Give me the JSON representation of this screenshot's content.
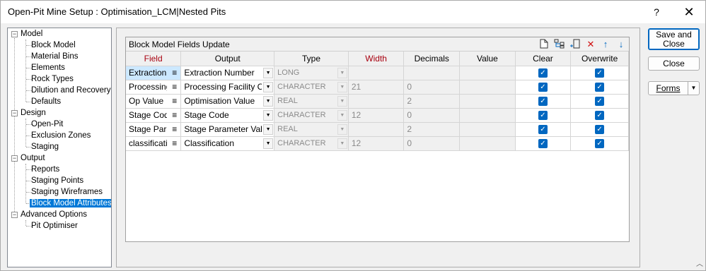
{
  "window": {
    "title": "Open-Pit Mine Setup : Optimisation_LCM|Nested Pits",
    "help_glyph": "?",
    "close_glyph": "✕"
  },
  "tree": {
    "groups": [
      {
        "label": "Model",
        "expand": "−",
        "children": [
          "Block Model",
          "Material Bins",
          "Elements",
          "Rock Types",
          "Dilution and Recovery",
          "Defaults"
        ]
      },
      {
        "label": "Design",
        "expand": "−",
        "children": [
          "Open-Pit",
          "Exclusion Zones",
          "Staging"
        ]
      },
      {
        "label": "Output",
        "expand": "−",
        "children": [
          "Reports",
          "Staging Points",
          "Staging Wireframes",
          "Block Model Attributes"
        ]
      },
      {
        "label": "Advanced Options",
        "expand": "−",
        "children": [
          "Pit Optimiser"
        ]
      }
    ],
    "selected": "Block Model Attributes"
  },
  "grid": {
    "title": "Block Model Fields Update",
    "columns": [
      "Field",
      "Output",
      "Type",
      "Width",
      "Decimals",
      "Value",
      "Clear",
      "Overwrite"
    ],
    "field_menu_glyph": "≡",
    "dropdown_glyph": "▼",
    "check_glyph": "✓",
    "rows": [
      {
        "field": "Extraction",
        "output": "Extraction Number",
        "type": "LONG",
        "width": "",
        "decimals": "",
        "value": "",
        "clear": true,
        "overwrite": true
      },
      {
        "field": "Processing",
        "output": "Processing Facility Costs",
        "type": "CHARACTER",
        "width": "21",
        "decimals": "0",
        "value": "",
        "clear": true,
        "overwrite": true
      },
      {
        "field": "Op Value",
        "output": "Optimisation Value",
        "type": "REAL",
        "width": "",
        "decimals": "2",
        "value": "",
        "clear": true,
        "overwrite": true
      },
      {
        "field": "Stage Code",
        "output": "Stage Code",
        "type": "CHARACTER",
        "width": "12",
        "decimals": "0",
        "value": "",
        "clear": true,
        "overwrite": true
      },
      {
        "field": "Stage Parameter",
        "output": "Stage Parameter Value",
        "type": "REAL",
        "width": "",
        "decimals": "2",
        "value": "",
        "clear": true,
        "overwrite": true
      },
      {
        "field": "classification",
        "output": "Classification",
        "type": "CHARACTER",
        "width": "12",
        "decimals": "0",
        "value": "",
        "clear": true,
        "overwrite": true
      }
    ],
    "toolbar": {
      "new_icon": "new-document-icon",
      "tree_icon": "insert-tree-icon",
      "insert_icon": "insert-row-icon",
      "delete_icon": "delete-icon",
      "up_icon": "move-up-icon",
      "down_icon": "move-down-icon"
    }
  },
  "buttons": {
    "save_close": "Save and Close",
    "close": "Close",
    "forms": "Forms",
    "forms_caret": "▼"
  },
  "colors": {
    "accent": "#0067c0",
    "selection": "#0078d7",
    "header_red": "#a8000f",
    "delete_red": "#d01010"
  }
}
